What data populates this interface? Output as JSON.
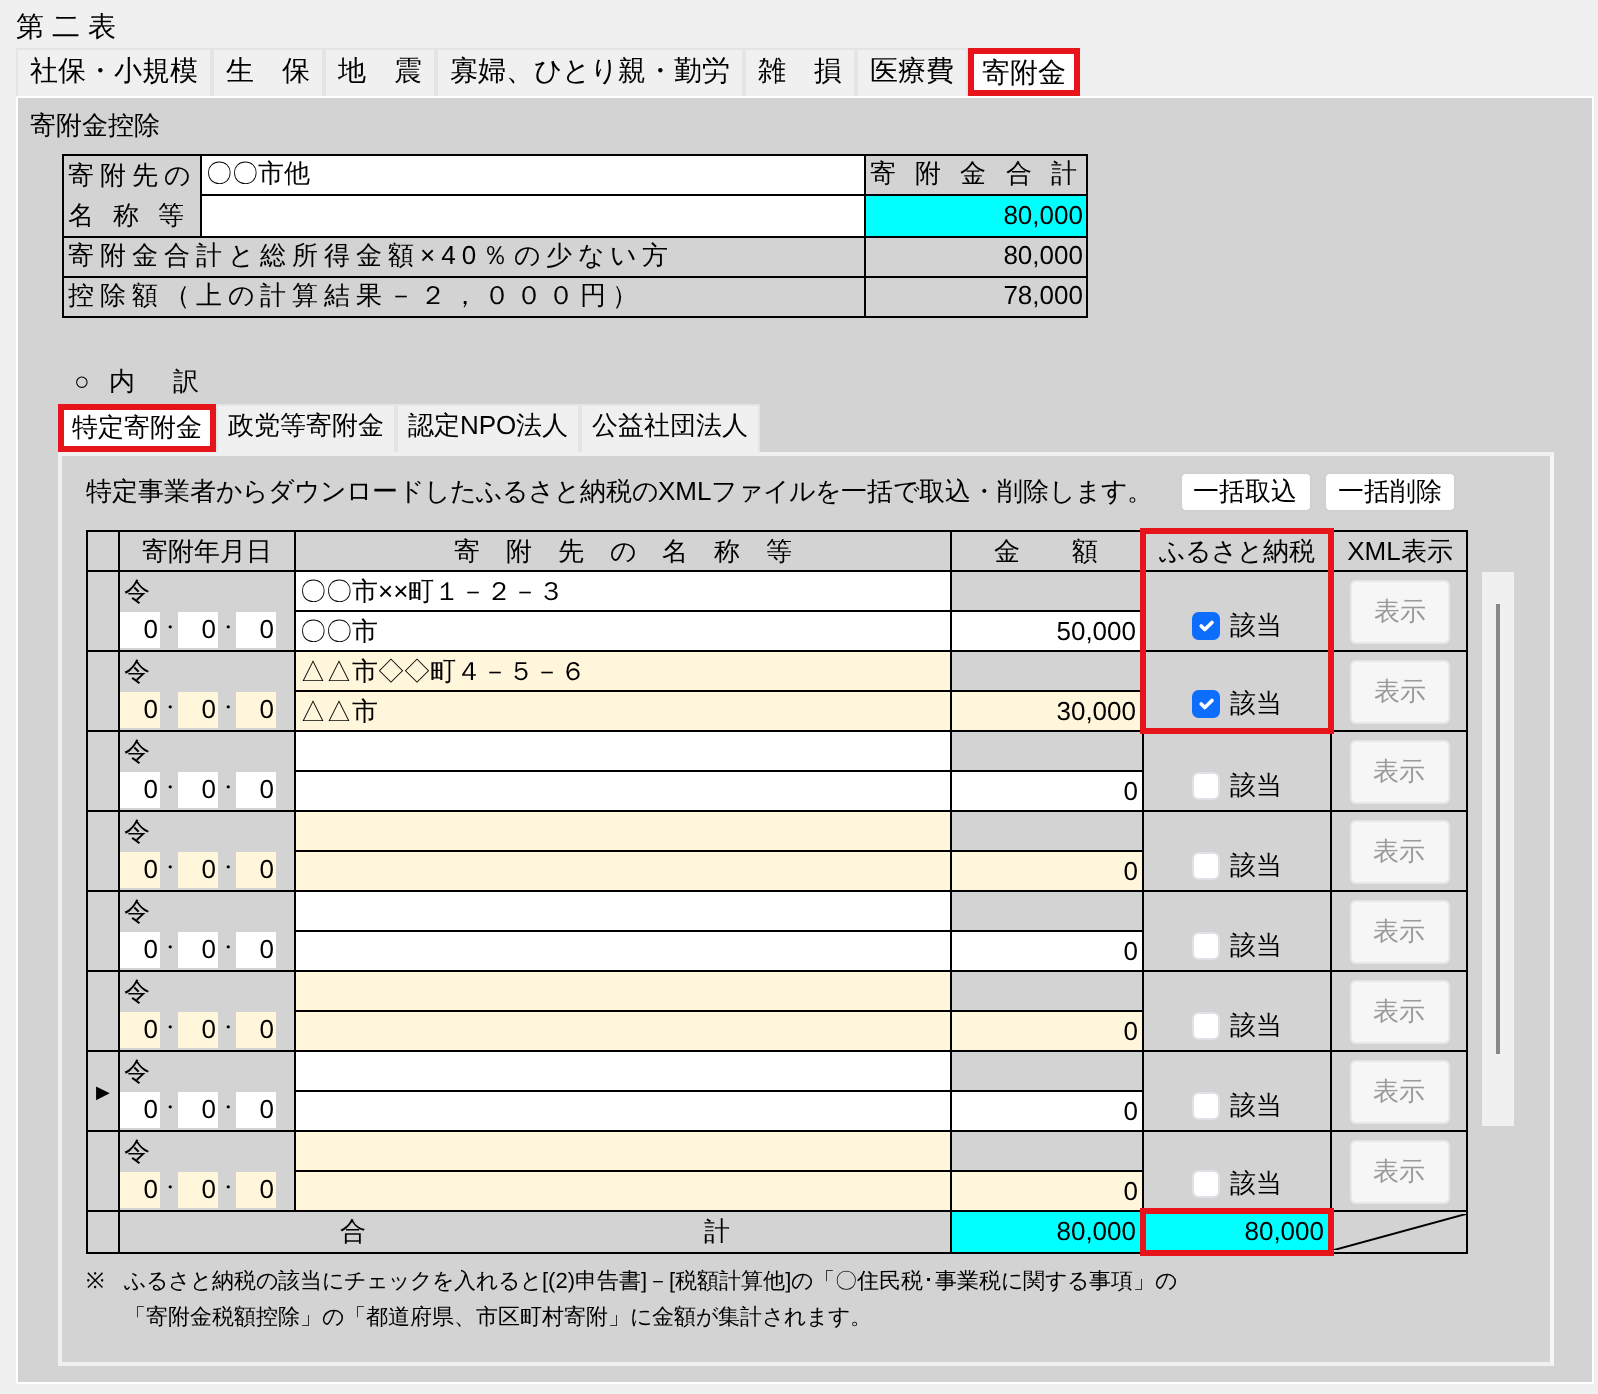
{
  "section_title": "第 二 表",
  "tabs": [
    {
      "label": "社保・小規模",
      "selected": false
    },
    {
      "label": "生　保",
      "selected": false
    },
    {
      "label": "地　震",
      "selected": false
    },
    {
      "label": "寡婦、ひとり親・勤労",
      "selected": false
    },
    {
      "label": "雑　損",
      "selected": false
    },
    {
      "label": "医療費",
      "selected": false
    },
    {
      "label": "寄附金",
      "selected": true
    }
  ],
  "panel_title": "寄附金控除",
  "summary": {
    "name_label": [
      "寄附先の",
      "名 称 等"
    ],
    "name_lines": [
      "〇〇市他"
    ],
    "total_label": "寄 附 金 合 計",
    "total_value": "80,000",
    "rows": [
      {
        "label": "寄附金合計と総所得金額×40％の少ない方",
        "value": "80,000"
      },
      {
        "label": "控除額（上の計算結果－２，０００円）",
        "value": "78,000"
      }
    ]
  },
  "breakdown_label": "○ 内　訳",
  "subtabs": [
    {
      "label": "特定寄附金",
      "selected": true
    },
    {
      "label": "政党等寄附金",
      "selected": false
    },
    {
      "label": "認定NPO法人",
      "selected": false
    },
    {
      "label": "公益社団法人",
      "selected": false
    }
  ],
  "description": "特定事業者からダウンロードしたふるさと納税のXMLファイルを一括で取込・削除します。",
  "buttons": [
    "一括取込",
    "一括削除"
  ],
  "grid": {
    "columns": [
      {
        "label": "寄附年月日",
        "highlight": false
      },
      {
        "label": "寄　附　先　の　名　称　等",
        "highlight": false
      },
      {
        "label": "金　　額",
        "highlight": false
      },
      {
        "label": "ふるさと納税",
        "highlight": true
      },
      {
        "label": "XML表示",
        "highlight": false
      }
    ],
    "records": [
      {
        "era": "令",
        "date": [
          "0",
          "・",
          "0",
          "・",
          "0"
        ],
        "address": "〇〇市××町１－２－３",
        "name": "〇〇市",
        "amount": "50,000",
        "furusato": {
          "label": "該当",
          "checked": true
        },
        "xml_button": {
          "label": "表示",
          "disabled": true
        },
        "highlight": true
      },
      {
        "era": "令",
        "date": [
          "0",
          "・",
          "0",
          "・",
          "0"
        ],
        "address": "△△市◇◇町４－５－６",
        "name": "△△市",
        "amount": "30,000",
        "furusato": {
          "label": "該当",
          "checked": true
        },
        "xml_button": {
          "label": "表示",
          "disabled": true
        },
        "highlight": true
      },
      {
        "era": "令",
        "date": [
          "0",
          "・",
          "0",
          "・",
          "0"
        ],
        "amount": "0",
        "furusato": {
          "label": "該当",
          "checked": false
        },
        "xml_button": {
          "label": "表示",
          "disabled": true
        },
        "highlight": false
      },
      {
        "era": "令",
        "date": [
          "0",
          "・",
          "0",
          "・",
          "0"
        ],
        "amount": "0",
        "furusato": {
          "label": "該当",
          "checked": false
        },
        "xml_button": {
          "label": "表示",
          "disabled": true
        },
        "highlight": false
      },
      {
        "era": "令",
        "date": [
          "0",
          "・",
          "0",
          "・",
          "0"
        ],
        "amount": "0",
        "furusato": {
          "label": "該当",
          "checked": false
        },
        "xml_button": {
          "label": "表示",
          "disabled": true
        },
        "highlight": false
      },
      {
        "era": "令",
        "date": [
          "0",
          "・",
          "0",
          "・",
          "0"
        ],
        "amount": "0",
        "furusato": {
          "label": "該当",
          "checked": false
        },
        "xml_button": {
          "label": "表示",
          "disabled": true
        },
        "highlight": false
      },
      {
        "era": "令",
        "date": [
          "0",
          "・",
          "0",
          "・",
          "0"
        ],
        "amount": "0",
        "furusato": {
          "label": "該当",
          "checked": false
        },
        "xml_button": {
          "label": "表示",
          "disabled": true
        },
        "marker": "▶",
        "highlight": false
      },
      {
        "era": "令",
        "date": [
          "0",
          "・",
          "0",
          "・",
          "0"
        ],
        "amount": "0",
        "furusato": {
          "label": "該当",
          "checked": false
        },
        "xml_button": {
          "label": "表示",
          "disabled": true
        },
        "highlight": false
      }
    ],
    "total": {
      "label": "合　　　　　　　　　　　　　計",
      "amount": "80,000",
      "furusato": "80,000",
      "furusato_highlight": true
    }
  },
  "note": {
    "mark": "※",
    "lines": [
      "ふるさと納税の該当にチェックを入れると[(2)申告書]－[税額計算他]の「〇住民税･事業税に関する事項」の",
      "「寄附金税額控除」の「都道府県、市区町村寄附」に金額が集計されます。"
    ]
  }
}
